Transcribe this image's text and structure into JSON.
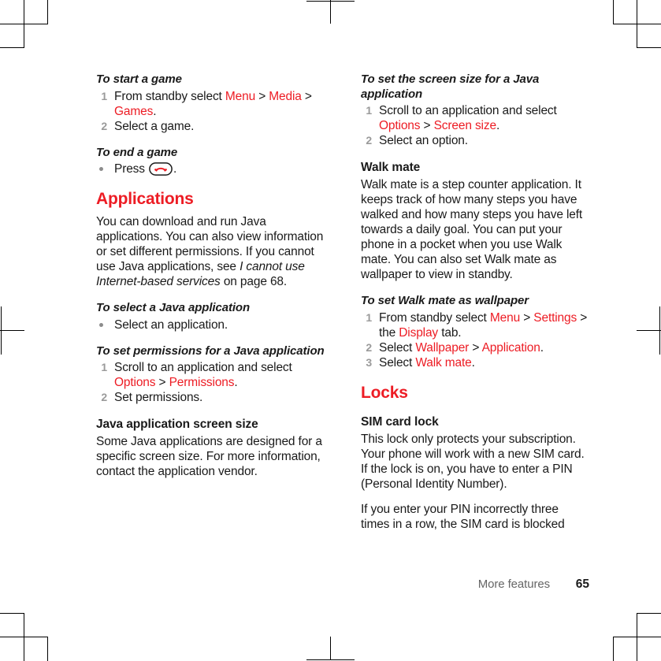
{
  "document": {
    "page_number": "65",
    "footer_section": "More features",
    "accent_color": "#ED1C24",
    "list_marker_color": "#9A9A9A"
  },
  "left_column": {
    "proc_start_game": {
      "title": "To start a game",
      "steps": [
        {
          "num": "1",
          "parts": [
            {
              "t": "From standby select ",
              "s": "plain"
            },
            {
              "t": "Menu",
              "s": "red"
            },
            {
              "t": " > ",
              "s": "plain"
            },
            {
              "t": "Media",
              "s": "red"
            },
            {
              "t": " > ",
              "s": "plain"
            },
            {
              "t": "Games",
              "s": "red"
            },
            {
              "t": ".",
              "s": "plain"
            }
          ]
        },
        {
          "num": "2",
          "parts": [
            {
              "t": "Select a game.",
              "s": "plain"
            }
          ]
        }
      ]
    },
    "proc_end_game": {
      "title": "To end a game",
      "steps": [
        {
          "num": "•",
          "parts": [
            {
              "t": "Press ",
              "s": "plain"
            },
            {
              "t": "",
              "s": "endcall-key-icon"
            },
            {
              "t": ".",
              "s": "plain"
            }
          ]
        }
      ]
    },
    "applications": {
      "heading": "Applications",
      "paragraph_parts": [
        {
          "t": "You can download and run Java applications. You can also view information or set different permissions. If you cannot use Java applications, see ",
          "s": "plain"
        },
        {
          "t": "I cannot use Internet-based services",
          "s": "italic"
        },
        {
          "t": " on page 68.",
          "s": "plain"
        }
      ]
    },
    "proc_select_java": {
      "title": "To select a Java application",
      "steps": [
        {
          "num": "•",
          "parts": [
            {
              "t": "Select an application.",
              "s": "plain"
            }
          ]
        }
      ]
    },
    "proc_permissions": {
      "title": "To set permissions for a Java application",
      "steps": [
        {
          "num": "1",
          "parts": [
            {
              "t": "Scroll to an application and select ",
              "s": "plain"
            },
            {
              "t": "Options",
              "s": "red"
            },
            {
              "t": " > ",
              "s": "plain"
            },
            {
              "t": "Permissions",
              "s": "red"
            },
            {
              "t": ".",
              "s": "plain"
            }
          ]
        },
        {
          "num": "2",
          "parts": [
            {
              "t": "Set permissions.",
              "s": "plain"
            }
          ]
        }
      ]
    },
    "java_screen_size": {
      "heading": "Java application screen size",
      "paragraph_parts": [
        {
          "t": "Some Java applications are designed for a specific screen size. For more information, contact the application vendor.",
          "s": "plain"
        }
      ]
    }
  },
  "right_column": {
    "proc_screen_size": {
      "title": "To set the screen size for a Java application",
      "steps": [
        {
          "num": "1",
          "parts": [
            {
              "t": "Scroll to an application and select ",
              "s": "plain"
            },
            {
              "t": "Options",
              "s": "red"
            },
            {
              "t": " > ",
              "s": "plain"
            },
            {
              "t": "Screen size",
              "s": "red"
            },
            {
              "t": ".",
              "s": "plain"
            }
          ]
        },
        {
          "num": "2",
          "parts": [
            {
              "t": "Select an option.",
              "s": "plain"
            }
          ]
        }
      ]
    },
    "walk_mate": {
      "heading": "Walk mate",
      "paragraph_parts": [
        {
          "t": "Walk mate is a step counter application. It keeps track of how many steps you have walked and how many steps you have left towards a daily goal. You can put your phone in a pocket when you use Walk mate. You can also set Walk mate as wallpaper to view in standby.",
          "s": "plain"
        }
      ]
    },
    "proc_walk_wallpaper": {
      "title": "To set Walk mate as wallpaper",
      "steps": [
        {
          "num": "1",
          "parts": [
            {
              "t": "From standby select ",
              "s": "plain"
            },
            {
              "t": "Menu",
              "s": "red"
            },
            {
              "t": " > ",
              "s": "plain"
            },
            {
              "t": "Settings",
              "s": "red"
            },
            {
              "t": " > the ",
              "s": "plain"
            },
            {
              "t": "Display",
              "s": "red"
            },
            {
              "t": " tab.",
              "s": "plain"
            }
          ]
        },
        {
          "num": "2",
          "parts": [
            {
              "t": "Select ",
              "s": "plain"
            },
            {
              "t": "Wallpaper",
              "s": "red"
            },
            {
              "t": " > ",
              "s": "plain"
            },
            {
              "t": "Application",
              "s": "red"
            },
            {
              "t": ".",
              "s": "plain"
            }
          ]
        },
        {
          "num": "3",
          "parts": [
            {
              "t": "Select ",
              "s": "plain"
            },
            {
              "t": "Walk mate",
              "s": "red"
            },
            {
              "t": ".",
              "s": "plain"
            }
          ]
        }
      ]
    },
    "locks": {
      "heading": "Locks",
      "sim_card_lock": {
        "heading": "SIM card lock",
        "paragraph1_parts": [
          {
            "t": "This lock only protects your subscription. Your phone will work with a new SIM card. If the lock is on, you have to enter a PIN (Personal Identity Number).",
            "s": "plain"
          }
        ],
        "paragraph2_parts": [
          {
            "t": "If you enter your PIN incorrectly three times in a row, the SIM card is blocked",
            "s": "plain"
          }
        ]
      }
    }
  }
}
